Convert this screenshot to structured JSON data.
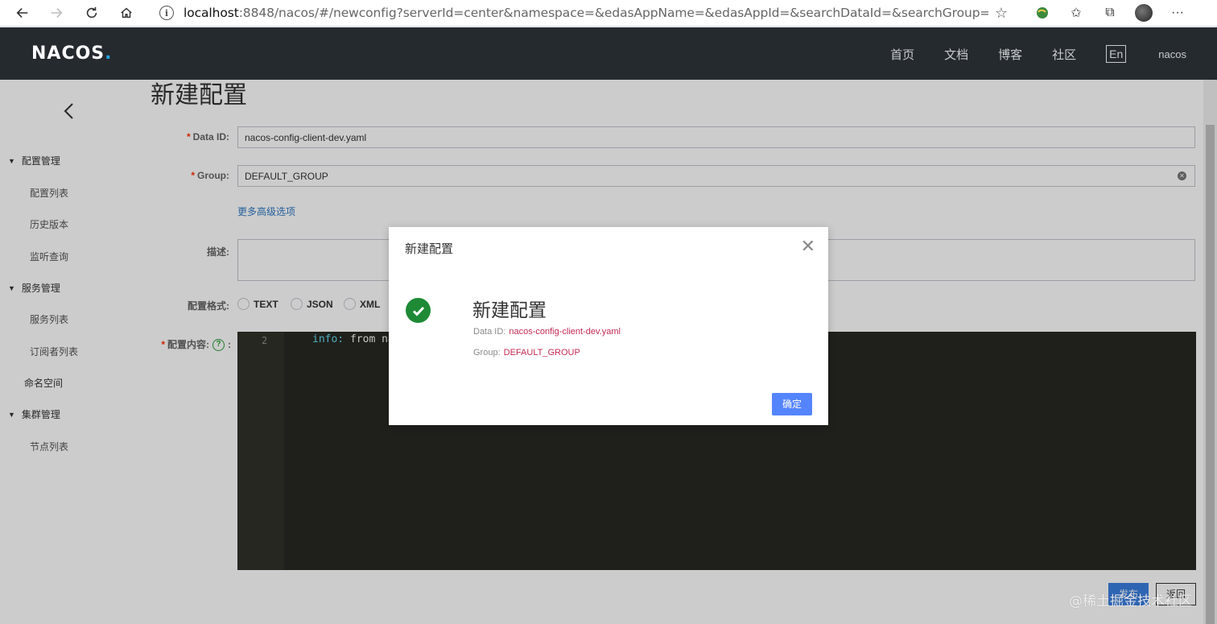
{
  "browser": {
    "url_host": "localhost",
    "url_rest": ":8848/nacos/#/newconfig?serverId=center&namespace=&edasAppName=&edasAppId=&searchDataId=&searchGroup=&group=D..."
  },
  "header": {
    "logo": "NACOS",
    "logo_dot": ".",
    "nav": [
      "首页",
      "文档",
      "博客",
      "社区"
    ],
    "lang": "En",
    "user": "nacos"
  },
  "sidebar": {
    "groups": [
      {
        "label": "配置管理",
        "items": [
          "配置列表",
          "历史版本",
          "监听查询"
        ]
      },
      {
        "label": "服务管理",
        "items": [
          "服务列表",
          "订阅者列表"
        ]
      },
      {
        "label": "命名空间"
      },
      {
        "label": "集群管理",
        "items": [
          "节点列表"
        ]
      }
    ]
  },
  "form": {
    "title": "新建配置",
    "data_id_label": "Data ID:",
    "data_id_value": "nacos-config-client-dev.yaml",
    "group_label": "Group:",
    "group_value": "DEFAULT_GROUP",
    "more_options": "更多高级选项",
    "desc_label": "描述:",
    "format_label": "配置格式:",
    "formats": [
      "TEXT",
      "JSON",
      "XML"
    ],
    "content_label": "配置内容:",
    "help": "?",
    "colon": ":",
    "editor_line_no": "2",
    "editor_key": "info:",
    "editor_val": " from na",
    "publish_btn": "发布",
    "back_btn": "返回"
  },
  "dialog": {
    "title": "新建配置",
    "heading": "新建配置",
    "data_id_label": "Data ID:",
    "data_id_value": "nacos-config-client-dev.yaml",
    "group_label": "Group:",
    "group_value": "DEFAULT_GROUP",
    "ok": "确定"
  },
  "watermark": "@稀土掘金技术社区",
  "colors": {
    "success": "#1e8a36",
    "primary": "#5584ff",
    "header_bg": "#252a2f",
    "value_text": "#c42a51"
  }
}
